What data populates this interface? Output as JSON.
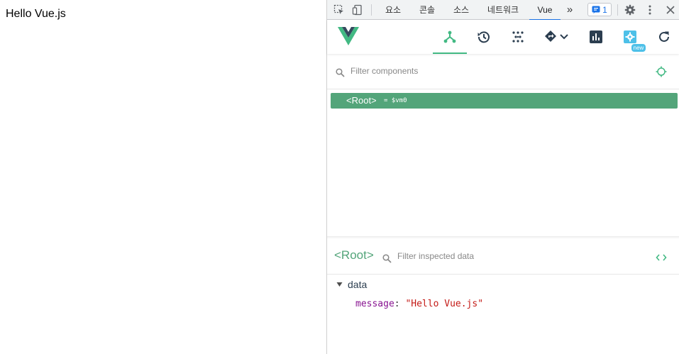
{
  "page": {
    "text": "Hello Vue.js"
  },
  "devtools": {
    "tabs": [
      "요소",
      "콘솔",
      "소스",
      "네트워크",
      "Vue"
    ],
    "active_tab": "Vue",
    "more_tabs": "»",
    "issues_count": "1"
  },
  "vue": {
    "new_badge": "new",
    "filter_placeholder": "Filter components",
    "tree": {
      "tag": "<Root>",
      "vm": "= $vm0"
    },
    "inspector": {
      "title": "<Root>",
      "filter_placeholder": "Filter inspected data",
      "section": "data",
      "props": [
        {
          "key": "message",
          "value": "\"Hello Vue.js\""
        }
      ]
    }
  },
  "colors": {
    "vue_green": "#42b983",
    "selected_row": "#53a57a",
    "vue_navy": "#35495e",
    "settings_blue": "#4dc0e8"
  }
}
